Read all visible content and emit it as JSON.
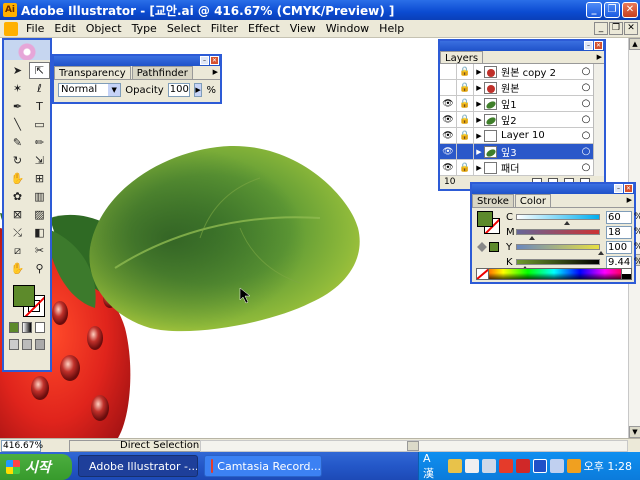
{
  "window": {
    "title": "Adobe Illustrator - [교안.ai @ 416.67% (CMYK/Preview) ]",
    "controls": [
      "_",
      "❐",
      "✕"
    ]
  },
  "menu": {
    "items": [
      "File",
      "Edit",
      "Object",
      "Type",
      "Select",
      "Filter",
      "Effect",
      "View",
      "Window",
      "Help"
    ]
  },
  "transparency": {
    "tabs": [
      "Transparency",
      "Pathfinder"
    ],
    "blend_mode": "Normal",
    "opacity_label": "Opacity",
    "opacity_value": "100",
    "percent": "%"
  },
  "layers": {
    "tab": "Layers",
    "rows": [
      {
        "name": "원본 copy 2",
        "visible": false,
        "locked": true,
        "thumb": "red",
        "selected": false
      },
      {
        "name": "원본",
        "visible": false,
        "locked": true,
        "thumb": "red",
        "selected": false
      },
      {
        "name": "잎1",
        "visible": true,
        "locked": true,
        "thumb": "leaf",
        "selected": false
      },
      {
        "name": "잎2",
        "visible": true,
        "locked": true,
        "thumb": "leaf",
        "selected": false
      },
      {
        "name": "Layer 10",
        "visible": true,
        "locked": true,
        "thumb": "blank",
        "selected": false
      },
      {
        "name": "잎3",
        "visible": true,
        "locked": false,
        "thumb": "leaf",
        "selected": true
      },
      {
        "name": "패더",
        "visible": true,
        "locked": true,
        "thumb": "blank",
        "selected": false
      }
    ],
    "count": "10"
  },
  "color": {
    "tabs": [
      "Stroke",
      "Color"
    ],
    "channels": [
      {
        "label": "C",
        "value": "60",
        "pos": 0.6,
        "gradient": "linear-gradient(to right,#fff,#00aeef)"
      },
      {
        "label": "M",
        "value": "18",
        "pos": 0.18,
        "gradient": "linear-gradient(to right,#669,#c33)"
      },
      {
        "label": "Y",
        "value": "100",
        "pos": 1.0,
        "gradient": "linear-gradient(to right,#6a88c0,#e8e040)"
      },
      {
        "label": "K",
        "value": "9.44",
        "pos": 0.09,
        "gradient": "linear-gradient(to right,#6e9a2e,#000)"
      }
    ],
    "percent": "%",
    "fill_color": "#5d8a2b"
  },
  "status": {
    "zoom": "416.67%",
    "tool": "Direct Selection"
  },
  "taskbar": {
    "start": "시작",
    "tasks": [
      {
        "label": "Adobe Illustrator -...",
        "active": true
      },
      {
        "label": "Camtasia Record...",
        "active": false
      }
    ],
    "ime": "A 漢",
    "clock": "오후 1:28"
  },
  "toolbox": {
    "tools": [
      {
        "name": "selection-tool",
        "glyph": "➤"
      },
      {
        "name": "direct-selection-tool",
        "glyph": "⇱"
      },
      {
        "name": "magic-wand-tool",
        "glyph": "✶"
      },
      {
        "name": "lasso-tool",
        "glyph": "ℓ"
      },
      {
        "name": "pen-tool",
        "glyph": "✒"
      },
      {
        "name": "type-tool",
        "glyph": "T"
      },
      {
        "name": "line-tool",
        "glyph": "╲"
      },
      {
        "name": "rectangle-tool",
        "glyph": "▭"
      },
      {
        "name": "paintbrush-tool",
        "glyph": "✎"
      },
      {
        "name": "pencil-tool",
        "glyph": "✏"
      },
      {
        "name": "rotate-tool",
        "glyph": "↻"
      },
      {
        "name": "scale-tool",
        "glyph": "⇲"
      },
      {
        "name": "warp-tool",
        "glyph": "✋"
      },
      {
        "name": "free-transform-tool",
        "glyph": "⊞"
      },
      {
        "name": "symbol-sprayer-tool",
        "glyph": "✿"
      },
      {
        "name": "column-graph-tool",
        "glyph": "▥"
      },
      {
        "name": "mesh-tool",
        "glyph": "⊠"
      },
      {
        "name": "gradient-tool",
        "glyph": "▨"
      },
      {
        "name": "eyedropper-tool",
        "glyph": "⤯"
      },
      {
        "name": "blend-tool",
        "glyph": "◧"
      },
      {
        "name": "slice-tool",
        "glyph": "⧄"
      },
      {
        "name": "scissors-tool",
        "glyph": "✂"
      },
      {
        "name": "hand-tool",
        "glyph": "✋"
      },
      {
        "name": "zoom-tool",
        "glyph": "⚲"
      }
    ]
  }
}
